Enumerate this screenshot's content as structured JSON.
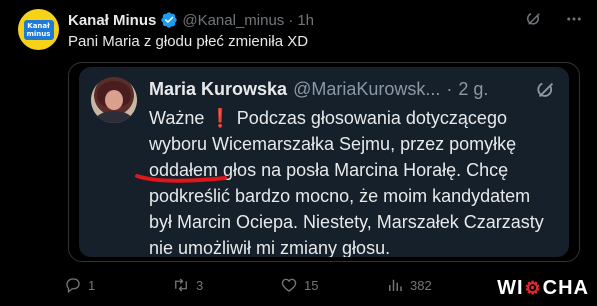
{
  "post": {
    "author_name": "Kanał Minus",
    "author_handle": "@Kanal_minus",
    "separator": "·",
    "time": "1h",
    "text": "Pani Maria z głodu płeć zmieniła XD",
    "avatar_logo_line1": "Kanał",
    "avatar_logo_line2": "minus"
  },
  "quote": {
    "author_name": "Maria Kurowska",
    "author_handle": "@MariaKurowsk...",
    "separator": "·",
    "time": "2 g.",
    "lines": {
      "l1a": "Ważne",
      "l1b": "❗",
      "l1c": " Podczas głosowania dotyczącego",
      "l2": "wyboru Wicemarszałka Sejmu, przez pomyłkę",
      "l3": "oddałem głos na posła Marcina Horałę. Chcę",
      "l4": "podkreślić bardzo mocno, że moim kandydatem",
      "l5": "był Marcin Ociepa. Niestety, Marszałek Czarzasty",
      "l6": "nie umożliwił mi zmiany głosu."
    }
  },
  "actions": {
    "reply_count": "1",
    "retweet_count": "3",
    "like_count": "15",
    "views_count": "382"
  },
  "watermark": {
    "part1": "WI",
    "gear": "⚙",
    "part2": "CHA"
  },
  "colors": {
    "background": "#000000",
    "text": "#e7e9ea",
    "muted": "#71767b",
    "verified": "#1d9bf0",
    "quote_bg": "#15202b",
    "annotation_red": "#e0161b"
  },
  "icons": {
    "verified": "verified-badge-icon",
    "grok": "grok-icon",
    "more": "more-icon",
    "reply": "reply-icon",
    "retweet": "retweet-icon",
    "like": "heart-icon",
    "views": "views-icon"
  }
}
